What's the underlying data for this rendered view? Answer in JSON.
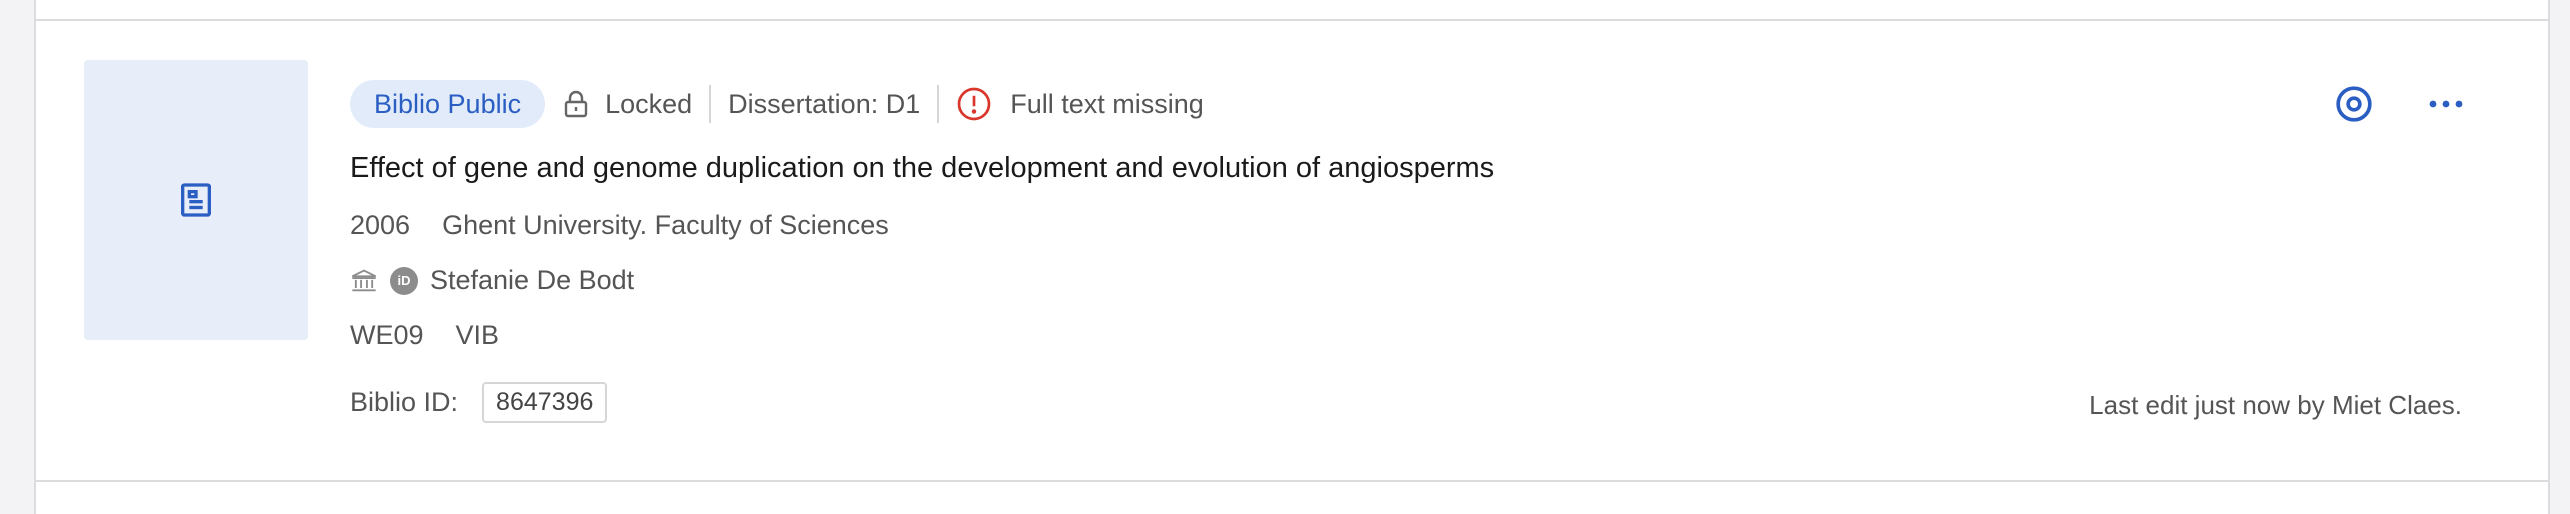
{
  "record": {
    "badge": "Biblio Public",
    "lock_label": "Locked",
    "type_label": "Dissertation: D1",
    "warning_label": "Full text missing",
    "title": "Effect of gene and genome duplication on the development and evolution of angiosperms",
    "year": "2006",
    "publisher": "Ghent University. Faculty of Sciences",
    "author": "Stefanie De Bodt",
    "orcid_badge": "iD",
    "departments": [
      "WE09",
      "VIB"
    ],
    "biblio_id_label": "Biblio ID:",
    "biblio_id": "8647396",
    "last_edit": "Last edit just now by Miet Claes."
  },
  "icons": {
    "thumbnail": "document-icon",
    "lock": "lock-icon",
    "warning": "alert-circle-icon",
    "view": "eye-icon",
    "more": "more-horizontal-icon",
    "institution": "institution-icon"
  },
  "colors": {
    "accent": "#2a5ec2",
    "badge_bg": "#e1ebfa",
    "thumb_bg": "#e7eef9",
    "warning": "#d9372b"
  }
}
